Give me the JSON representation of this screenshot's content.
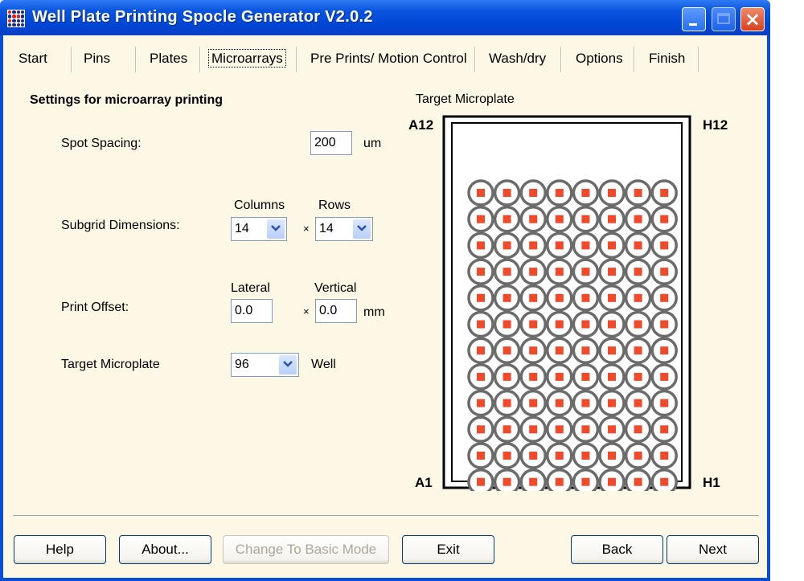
{
  "window": {
    "title": "Well Plate Printing Spocle Generator V2.0.2",
    "controls": {
      "minimize": "minimize",
      "maximize": "maximize",
      "close": "×"
    }
  },
  "tabs": [
    {
      "label": "Start",
      "active": false
    },
    {
      "label": "Pins",
      "active": false
    },
    {
      "label": "Plates",
      "active": false
    },
    {
      "label": "Microarrays",
      "active": true
    },
    {
      "label": "Pre Prints/ Motion Control",
      "active": false
    },
    {
      "label": "Wash/dry",
      "active": false
    },
    {
      "label": "Options",
      "active": false
    },
    {
      "label": "Finish",
      "active": false
    }
  ],
  "settings": {
    "title": "Settings for microarray printing",
    "spot_spacing": {
      "label": "Spot Spacing:",
      "value": "200",
      "unit": "um"
    },
    "subgrid": {
      "label": "Subgrid Dimensions:",
      "columns_label": "Columns",
      "columns_value": "14",
      "times": "×",
      "rows_label": "Rows",
      "rows_value": "14"
    },
    "print_offset": {
      "label": "Print Offset:",
      "lateral_label": "Lateral",
      "lateral_value": "0.0",
      "times": "×",
      "vertical_label": "Vertical",
      "vertical_value": "0.0",
      "unit": "mm"
    },
    "target_microplate": {
      "label": "Target Microplate",
      "value": "96",
      "unit": "Well"
    }
  },
  "plate": {
    "title": "Target Microplate",
    "corners": {
      "top_left": "A12",
      "top_right": "H12",
      "bottom_left": "A1",
      "bottom_right": "H1"
    },
    "columns": 8,
    "rows": 12,
    "well_color": "#6b6b6b",
    "spot_color": "#f04a2a"
  },
  "buttons": {
    "help": "Help",
    "about": "About...",
    "basic_mode": "Change To Basic Mode",
    "exit": "Exit",
    "back": "Back",
    "next": "Next"
  }
}
